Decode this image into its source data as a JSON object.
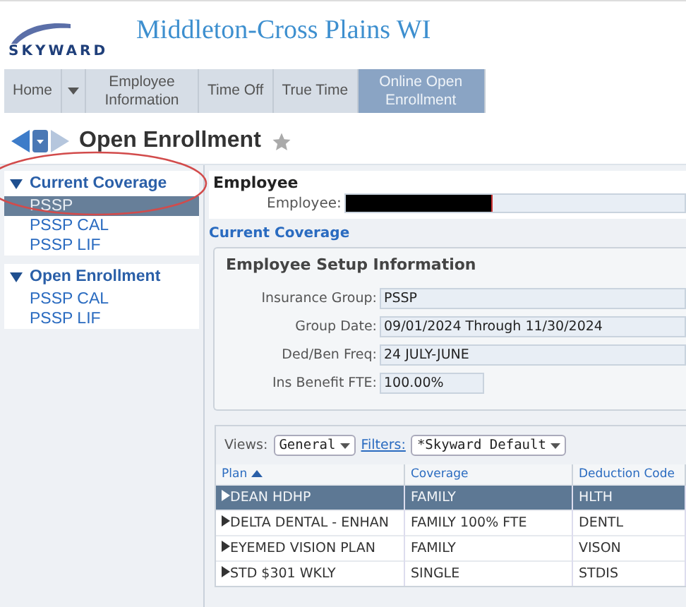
{
  "header": {
    "brand": "SKYWARD",
    "district": "Middleton-Cross Plains WI"
  },
  "nav": [
    {
      "label": "Home",
      "selected": false,
      "kind": "tab"
    },
    {
      "kind": "dropdown",
      "selected": false
    },
    {
      "label": "Employee Information",
      "selected": false,
      "kind": "tab"
    },
    {
      "label": "Time Off",
      "selected": false,
      "kind": "tab"
    },
    {
      "label": "True Time",
      "selected": false,
      "kind": "tab"
    },
    {
      "label": "Online Open Enrollment",
      "selected": true,
      "kind": "tab"
    }
  ],
  "page_title": "Open Enrollment",
  "sidebar": [
    {
      "heading": "Current Coverage",
      "expanded": true,
      "items": [
        {
          "label": "PSSP",
          "selected": true
        },
        {
          "label": "PSSP CAL",
          "selected": false
        },
        {
          "label": "PSSP LIF",
          "selected": false
        }
      ]
    },
    {
      "heading": "Open Enrollment",
      "expanded": true,
      "items": [
        {
          "label": "PSSP CAL",
          "selected": false
        },
        {
          "label": "PSSP LIF",
          "selected": false
        }
      ]
    }
  ],
  "employee": {
    "heading": "Employee",
    "label": "Employee:"
  },
  "current_coverage": {
    "heading": "Current Coverage",
    "panel_title": "Employee Setup Information",
    "fields": [
      {
        "label": "Insurance Group:",
        "value": "PSSP"
      },
      {
        "label": "Group Date:",
        "value": "09/01/2024 Through 11/30/2024"
      },
      {
        "label": "Ded/Ben Freq:",
        "value": "24 JULY-JUNE"
      },
      {
        "label": "Ins Benefit FTE:",
        "value": "100.00%"
      }
    ]
  },
  "grid": {
    "views_label": "Views:",
    "view": "General",
    "filters_label": "Filters:",
    "filter": "*Skyward Default",
    "columns": [
      "Plan",
      "Coverage",
      "Deduction Code"
    ],
    "rows": [
      {
        "cells": [
          "DEAN HDHP",
          "FAMILY",
          "HLTH"
        ],
        "selected": true
      },
      {
        "cells": [
          "DELTA DENTAL - ENHAN",
          "FAMILY 100% FTE",
          "DENTL"
        ],
        "selected": false
      },
      {
        "cells": [
          "EYEMED VISION PLAN",
          "FAMILY",
          "VISON"
        ],
        "selected": false
      },
      {
        "cells": [
          "STD $301 WKLY",
          "SINGLE",
          "STDIS"
        ],
        "selected": false
      }
    ]
  }
}
